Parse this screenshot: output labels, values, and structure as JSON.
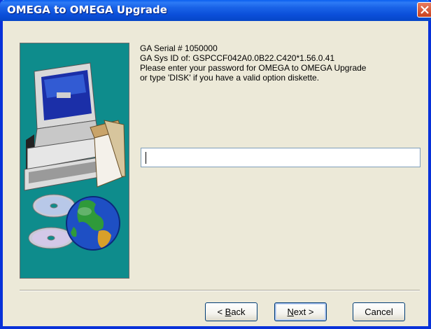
{
  "window": {
    "title": "OMEGA to OMEGA Upgrade"
  },
  "info": {
    "serial": "GA Serial # 1050000",
    "sys_id": "GA Sys ID of: GSPCCF042A0.0B22.C420*1.56.0.41",
    "prompt_line1": "Please enter your password for OMEGA to OMEGA Upgrade",
    "prompt_line2": "or type 'DISK' if you have a valid option diskette."
  },
  "password": {
    "value": ""
  },
  "buttons": {
    "back": {
      "label": "< Back",
      "accel": "B"
    },
    "next": {
      "label": "Next >",
      "accel": "N"
    },
    "cancel": {
      "label": "Cancel"
    }
  },
  "colors": {
    "titlebar": "#0a5ff0",
    "dialog_bg": "#ece9d8",
    "side_panel": "#0e8c8c"
  },
  "icons": [
    "close-icon",
    "computer-icon",
    "cd-icon",
    "globe-icon"
  ]
}
